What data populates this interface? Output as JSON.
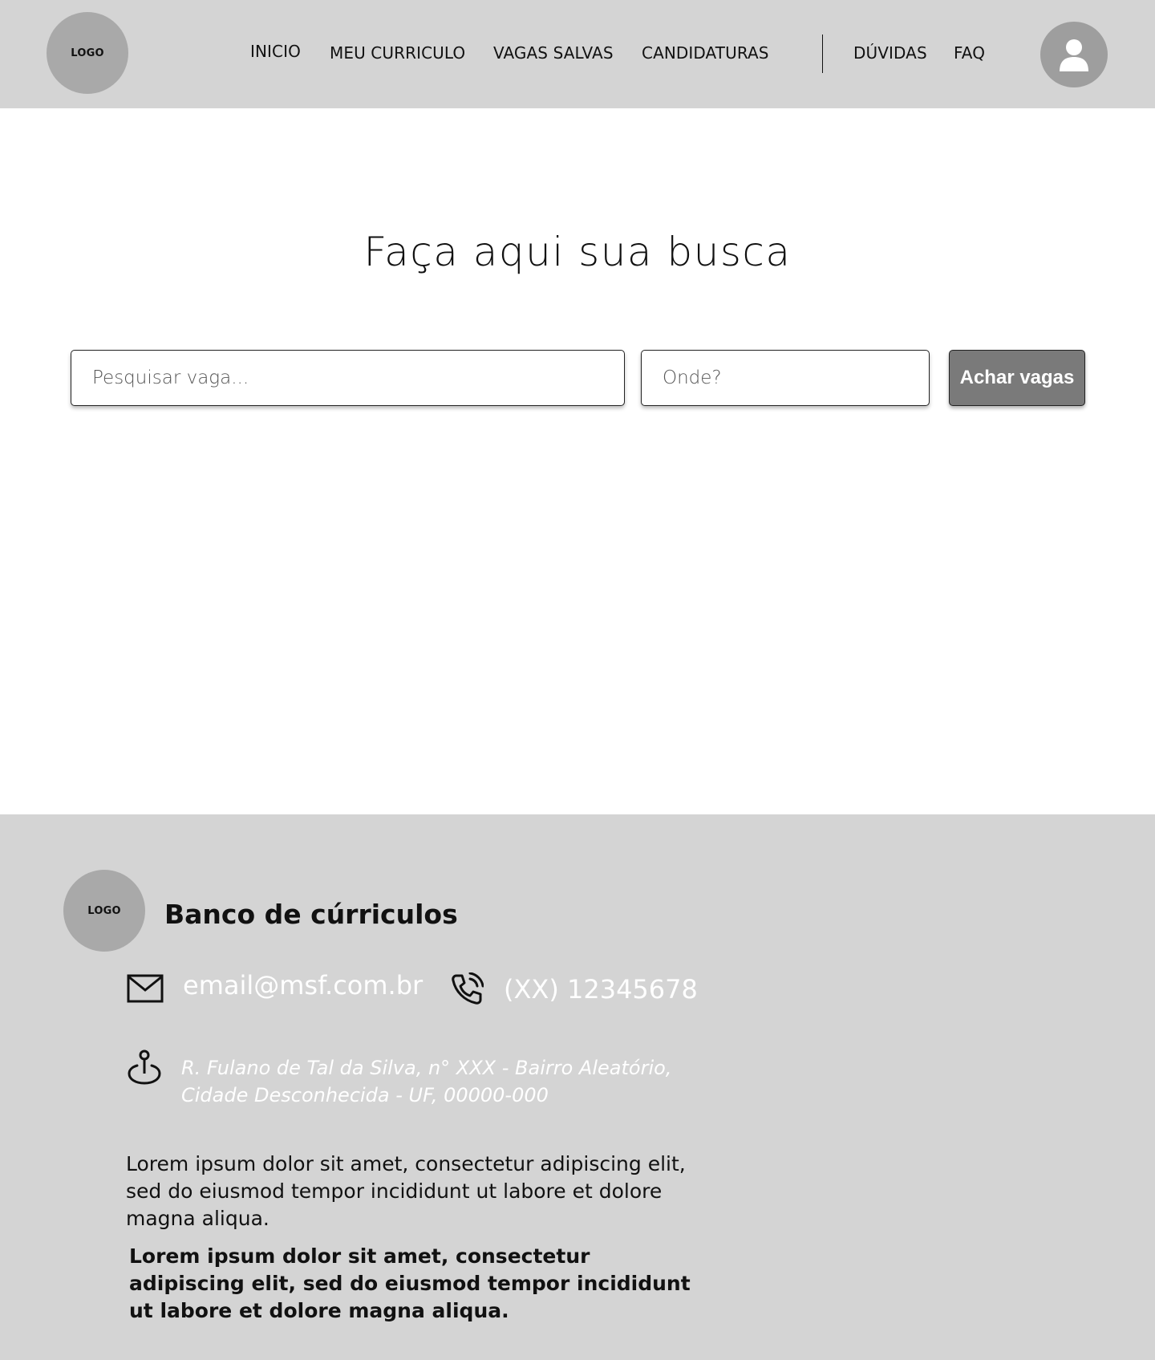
{
  "header": {
    "logo_text": "LOGO",
    "nav": [
      {
        "label": "INICIO"
      },
      {
        "label": "MEU CURRICULO"
      },
      {
        "label": "VAGAS SALVAS"
      },
      {
        "label": "CANDIDATURAS"
      },
      {
        "label": "DÚVIDAS"
      },
      {
        "label": "FAQ"
      }
    ],
    "avatar_icon": "user-icon"
  },
  "main": {
    "title": "Faça aqui sua busca",
    "search": {
      "job_placeholder": "Pesquisar vaga...",
      "location_placeholder": "Onde?",
      "button_label": "Achar vagas"
    }
  },
  "footer": {
    "logo_text": "LOGO",
    "brand": "Banco de cúrriculos",
    "email": "email@msf.com.br",
    "phone": "(XX) 12345678",
    "address_line1": "R. Fulano de Tal da Silva, n° XXX - Bairro Aleatório,",
    "address_line2": "Cidade Desconhecida - UF, 00000-000",
    "lorem_normal": "Lorem ipsum dolor sit amet, consectetur adipiscing elit, sed do eiusmod tempor incididunt ut labore et dolore magna aliqua.",
    "lorem_bold": "Lorem ipsum dolor sit amet, consectetur adipiscing elit, sed do eiusmod tempor incididunt ut labore et dolore magna aliqua.",
    "icons": [
      "mail-icon",
      "phone-icon",
      "location-pin-icon"
    ]
  },
  "colors": {
    "header_bg": "#d4d4d4",
    "footer_bg": "#d4d4d4",
    "logo_circle": "#a9a9a9",
    "button_bg": "#7a7a7a",
    "footer_contact_text": "#ffffff"
  }
}
